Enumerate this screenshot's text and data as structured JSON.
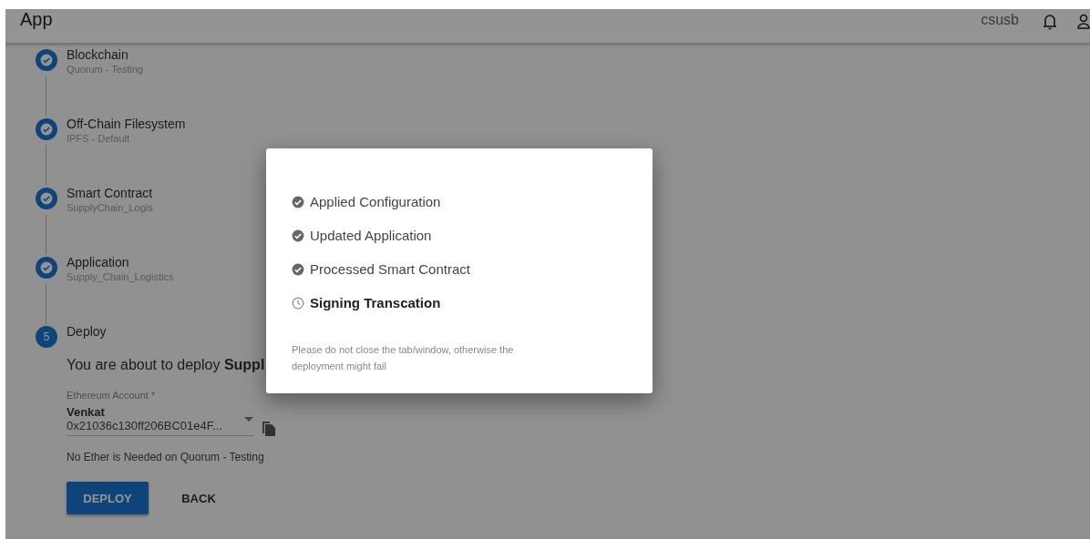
{
  "app_bar": {
    "title": "App",
    "user": "csusb"
  },
  "steps": [
    {
      "title": "Blockchain",
      "subtitle": "Quorum - Testing",
      "completed": true
    },
    {
      "title": "Off-Chain Filesystem",
      "subtitle": "IPFS - Default",
      "completed": true
    },
    {
      "title": "Smart Contract",
      "subtitle": "SupplyChain_Logis",
      "completed": true
    },
    {
      "title": "Application",
      "subtitle": "Supply_Chain_Logistics",
      "completed": true
    },
    {
      "title": "Deploy",
      "number": "5",
      "completed": false
    }
  ],
  "deploy": {
    "intro": "You are about to deploy **Suppl**",
    "account_field": {
      "label": "Ethereum Account *",
      "name": "Venkat",
      "address": "0x21036c130ff206BC01e4F..."
    },
    "note": "No Ether is Needed on Quorum - Testing",
    "buttons": [
      {
        "label": "DEPLOY",
        "primary": true
      },
      {
        "label": "BACK",
        "primary": false
      }
    ]
  },
  "dialog": {
    "items": [
      {
        "label": "Applied Configuration",
        "done": true
      },
      {
        "label": "Updated Application",
        "done": true
      },
      {
        "label": "Processed Smart Contract",
        "done": true
      },
      {
        "label": "Signing Transcation",
        "done": false
      }
    ],
    "warning": "Please do not close the tab/window, otherwise the deployment might fail"
  }
}
